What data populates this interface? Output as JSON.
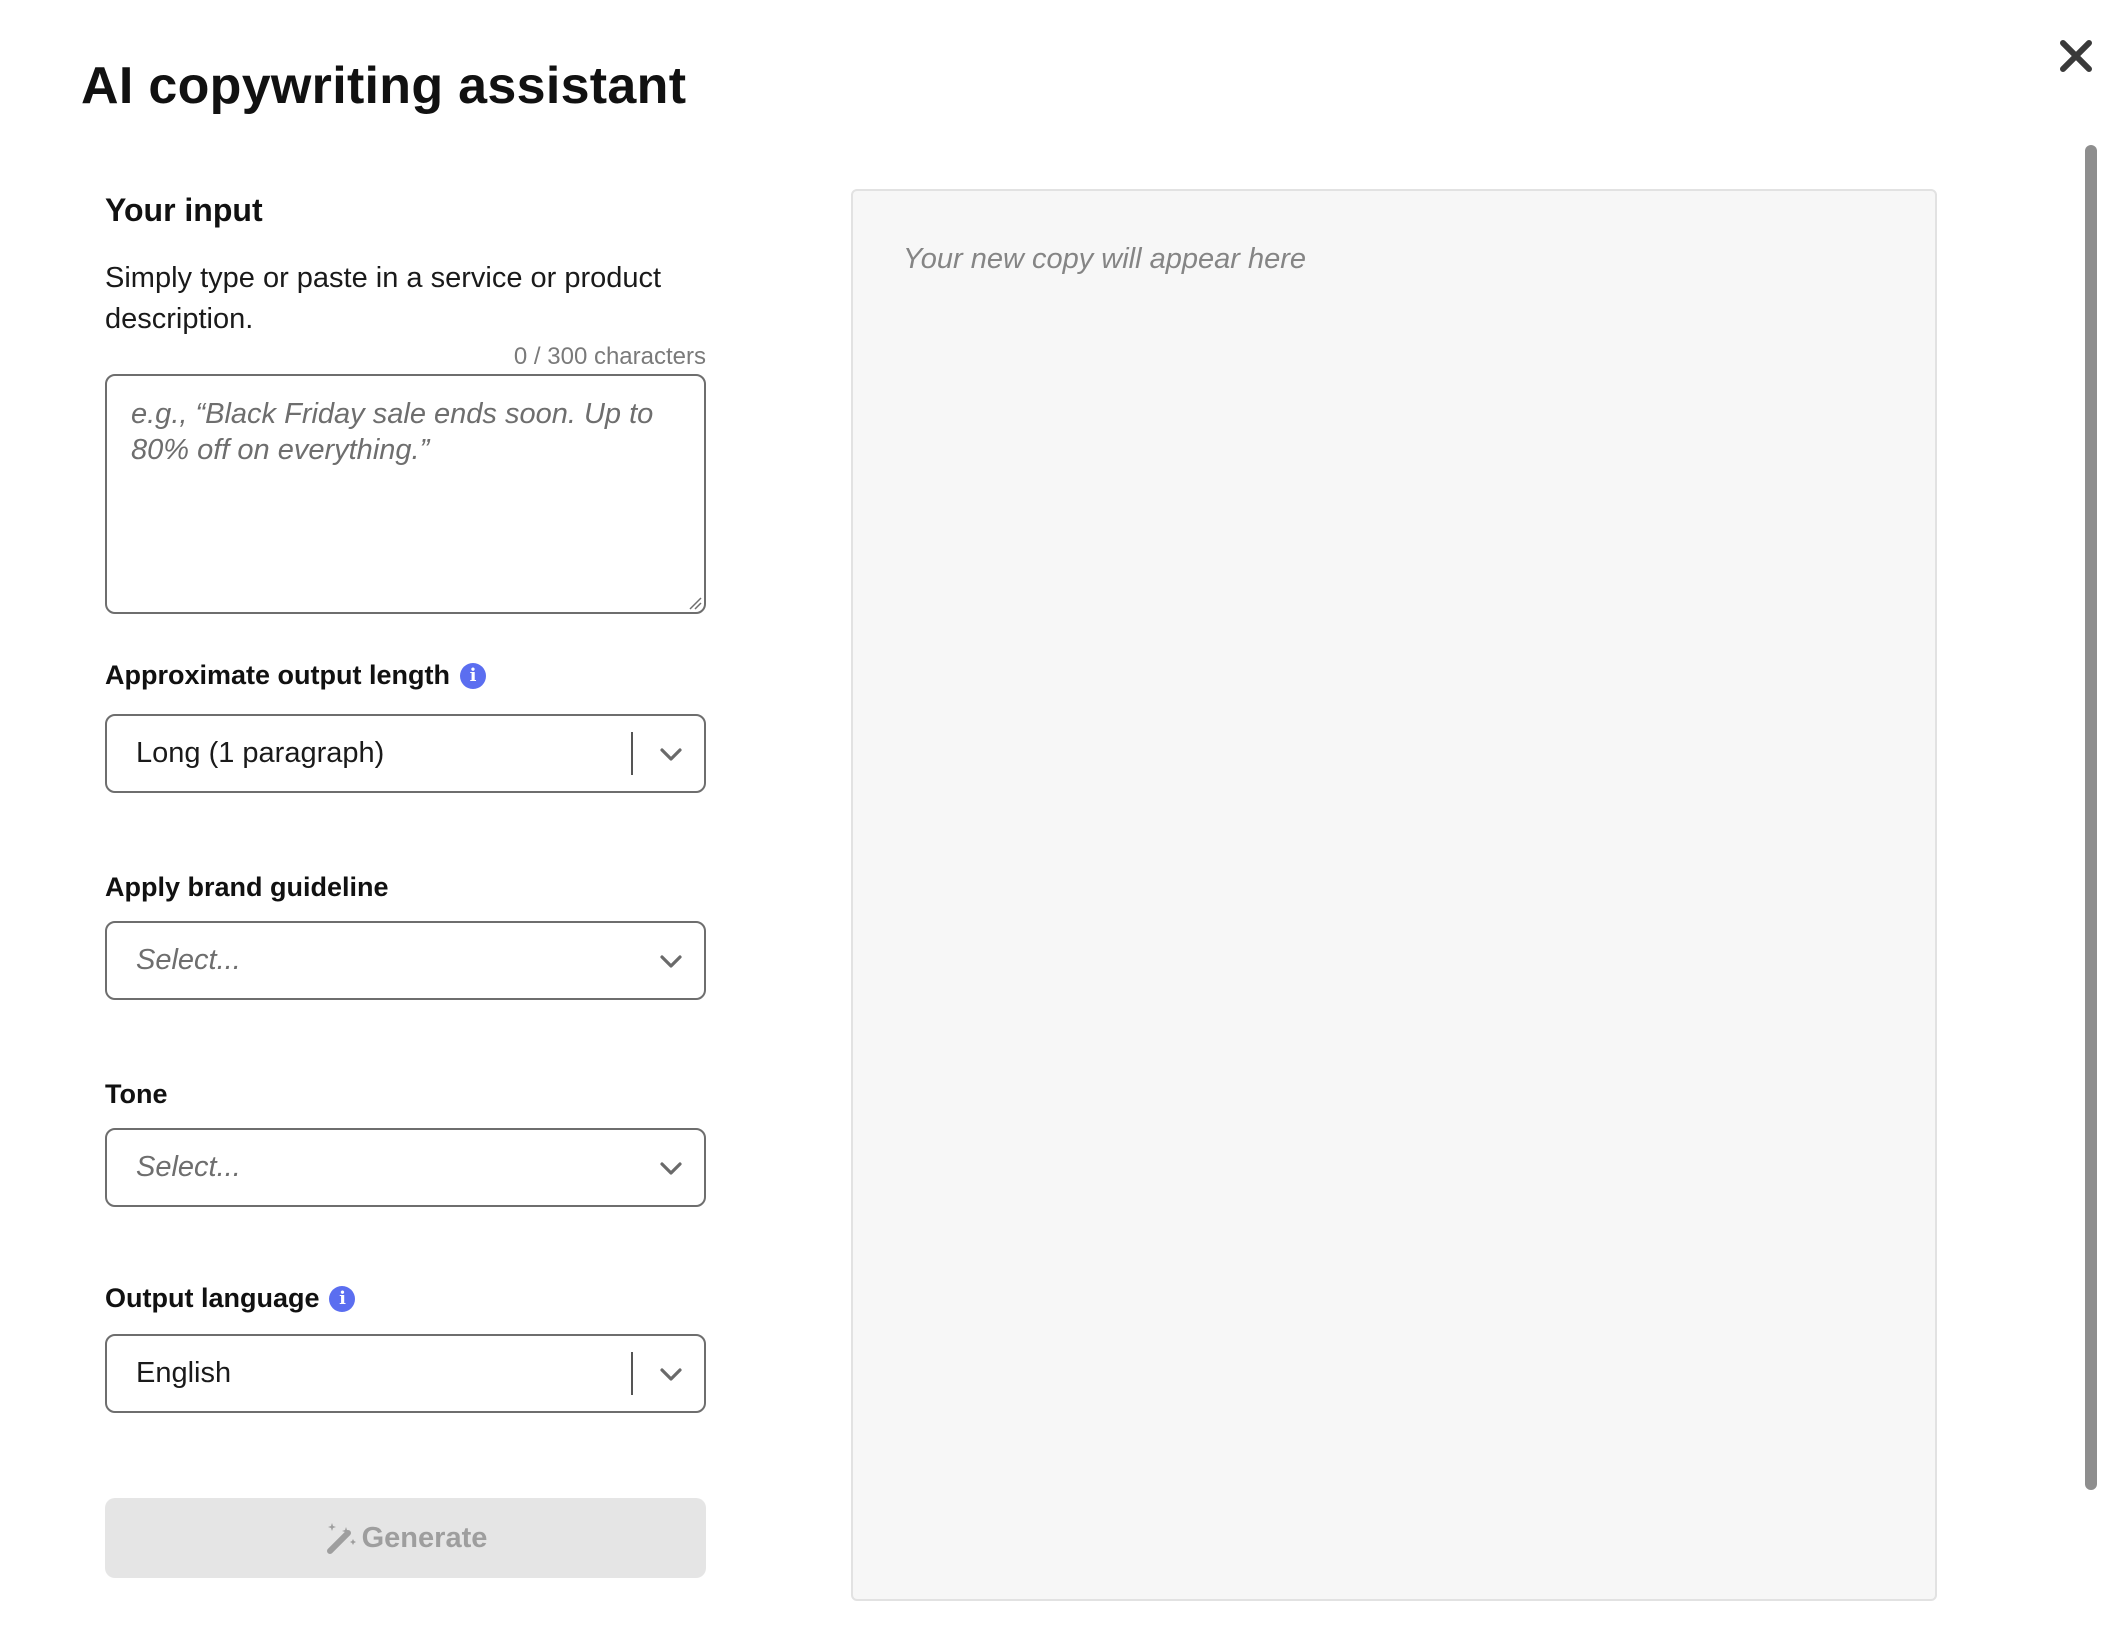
{
  "dialog": {
    "title": "AI copywriting assistant",
    "close_icon": "close-icon"
  },
  "input_section": {
    "heading": "Your input",
    "description": "Simply type or paste in a service or product description.",
    "char_count": "0 / 300 characters",
    "textarea_value": "",
    "textarea_placeholder": "e.g., “Black Friday sale ends soon. Up to 80% off on everything.”"
  },
  "fields": {
    "output_length": {
      "label": "Approximate output length",
      "has_info_icon": true,
      "selected": "Long (1 paragraph)"
    },
    "brand_guideline": {
      "label": "Apply brand guideline",
      "placeholder": "Select..."
    },
    "tone": {
      "label": "Tone",
      "placeholder": "Select..."
    },
    "output_language": {
      "label": "Output language",
      "has_info_icon": true,
      "selected": "English"
    }
  },
  "generate_button": {
    "label": "Generate",
    "icon": "magic-wand-icon",
    "disabled": true
  },
  "output_panel": {
    "placeholder": "Your new copy will appear here"
  },
  "colors": {
    "info_icon": "#5b6ef0",
    "disabled_button_bg": "#e5e5e5",
    "disabled_button_text": "#9e9e9e",
    "output_bg": "#f7f7f7",
    "border": "#6e6e6e"
  }
}
